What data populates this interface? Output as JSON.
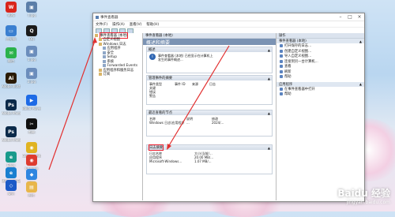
{
  "desktop": {
    "icons": [
      {
        "label": "WPS",
        "name": "wps-icon",
        "color": "#d9261c",
        "glyph": "W"
      },
      {
        "label": "7.jpg",
        "name": "image-file-icon",
        "color": "#5b7ea8",
        "glyph": "▣"
      },
      {
        "label": "此电脑",
        "name": "computer-icon",
        "color": "#3a7fd0",
        "glyph": "▭"
      },
      {
        "label": "QQ",
        "name": "qq-icon",
        "color": "#1b1b1b",
        "glyph": "Q"
      },
      {
        "label": "1.jpg",
        "name": "image-file-icon",
        "color": "#6b8dbc",
        "glyph": "▣"
      },
      {
        "label": "微信",
        "name": "wechat-icon",
        "color": "#2bb24c",
        "glyph": "✉"
      },
      {
        "label": "2.jpg",
        "name": "image-file-icon",
        "color": "#6b8dbc",
        "glyph": "▣"
      },
      {
        "label": "Adobe Illustrator",
        "name": "illustrator-icon",
        "color": "#2a1a04",
        "glyph": "Ai"
      },
      {
        "label": "Baidu Player",
        "name": "player-icon",
        "color": "#1e6be6",
        "glyph": "▶"
      },
      {
        "label": "Adobe Photosh...",
        "name": "photoshop-icon",
        "color": "#0b2a4a",
        "glyph": "Ps"
      },
      {
        "label": "剪映",
        "name": "capcut-icon",
        "color": "#111111",
        "glyph": "✂"
      },
      {
        "label": "Adobe Photosh...",
        "name": "photoshop-icon",
        "color": "#0b2a4a",
        "glyph": "Ps"
      },
      {
        "label": "Google Chrome",
        "name": "chrome-icon",
        "color": "#e0b321",
        "glyph": "◉"
      },
      {
        "label": "Edge",
        "name": "edge-icon",
        "color": "#1a9a8c",
        "glyph": "e"
      },
      {
        "label": "Chrome",
        "name": "chrome-icon",
        "color": "#de3b2f",
        "glyph": "◉"
      },
      {
        "label": "Microsoft Edge",
        "name": "edge-icon",
        "color": "#1a7fd0",
        "glyph": "e"
      },
      {
        "label": "腾讯",
        "name": "app-icon",
        "color": "#2f86e0",
        "glyph": "◆"
      },
      {
        "label": "安全",
        "name": "security-icon",
        "color": "#1c59c7",
        "glyph": "◇"
      },
      {
        "label": "图片",
        "name": "folder-icon",
        "color": "#e8b64a",
        "glyph": "▤"
      }
    ]
  },
  "window": {
    "title": "事件查看器",
    "menu": [
      "文件(F)",
      "操作(A)",
      "查看(V)",
      "帮助(H)"
    ],
    "tree": [
      {
        "label": "事件查看器 (本地)",
        "level": 0,
        "selected": true
      },
      {
        "label": "自定义视图",
        "level": 1
      },
      {
        "label": "Windows 日志",
        "level": 1
      },
      {
        "label": "应用程序",
        "level": 2
      },
      {
        "label": "安全",
        "level": 2
      },
      {
        "label": "Setup",
        "level": 2
      },
      {
        "label": "系统",
        "level": 2
      },
      {
        "label": "Forwarded Events",
        "level": 2
      },
      {
        "label": "应用程序和服务日志",
        "level": 1
      },
      {
        "label": "订阅",
        "level": 1
      }
    ],
    "center": {
      "header": "事件查看器 (本地)",
      "subheader": "概述和摘要",
      "overview_title": "概述",
      "overview_text": "事件查看器 (本地) 已经显示在计算机上发生的事件概述...",
      "summary_title": "管理事件的摘要",
      "summary_cols": [
        "事件类型",
        "事件 ID",
        "来源",
        "日志"
      ],
      "summary_rows": [
        "关键",
        "错误",
        "警告"
      ],
      "recent_title": "最近查看的节点",
      "recent_cols": [
        "名称",
        "说明",
        "修改"
      ],
      "recent_row": [
        "Windows 日志\\应用程序",
        "...",
        "2024/..."
      ],
      "logs_title": "日志摘要",
      "logs_cols": [
        "日志名称",
        "大小(当前/..."
      ],
      "logs_rows": [
        [
          "应用程序",
          "20.00 MB/..."
        ],
        [
          "Microsoft-Windows...",
          "1.07 MB/..."
        ]
      ]
    },
    "actions": {
      "header": "操作",
      "group1": "事件查看器 (本地)",
      "items1": [
        "打开保存的日志...",
        "创建自定义视图...",
        "导入自定义视图...",
        "连接到另一台计算机...",
        "查看",
        "刷新",
        "帮助"
      ],
      "group2": "应用程序",
      "items2": [
        "在事件查看器中打开",
        "帮助"
      ]
    }
  },
  "watermark": {
    "brand": "Baidu 经验",
    "url": "jingyan.baidu.com"
  },
  "colors": {
    "highlight": "#e23030",
    "accent": "#7b93b3"
  }
}
